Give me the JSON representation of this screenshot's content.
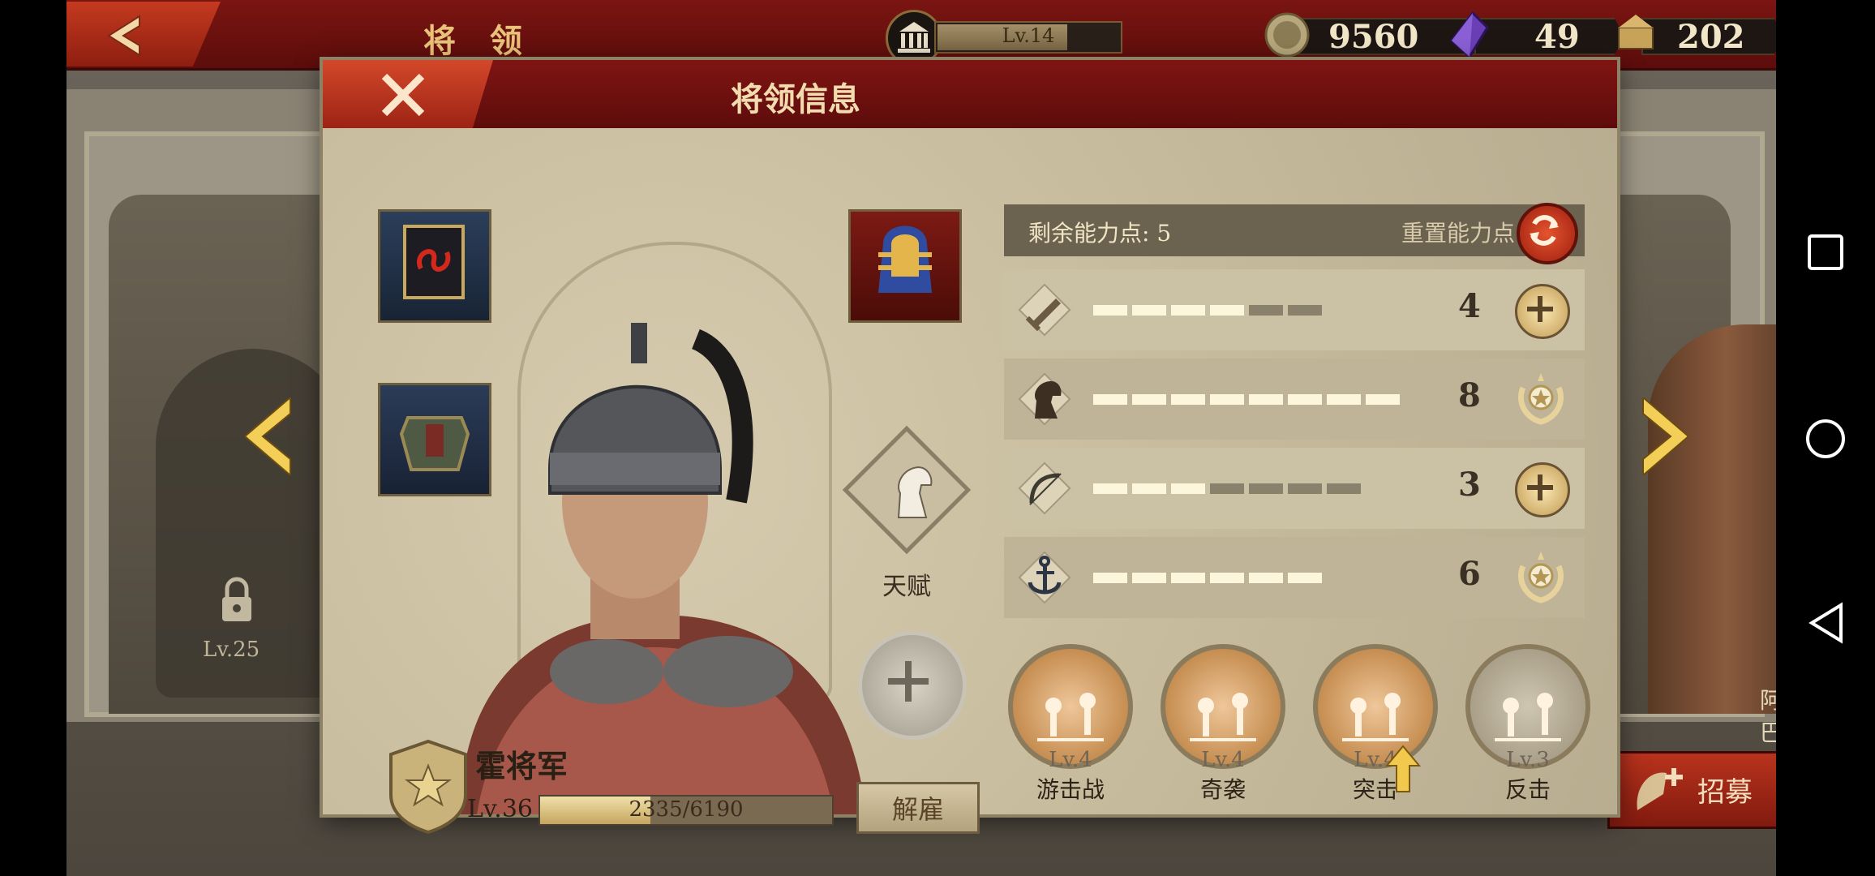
{
  "topbar": {
    "title": "将 领",
    "building_level": "Lv.14",
    "building_progress": 0.7,
    "coins": "9560",
    "gems": "49",
    "laurels": "202"
  },
  "background": {
    "locked_level": "Lv.25",
    "right_name": "阿巴达",
    "recruit_label": "招募"
  },
  "dialog": {
    "title": "将领信息",
    "talent_label": "天赋",
    "general": {
      "name": "霍将军",
      "level": "Lv.36",
      "xp_current": 2335,
      "xp_max": 6190,
      "xp_text": "2335/6190",
      "dismiss_label": "解雇"
    },
    "points": {
      "remaining_label": "剩余能力点: 5",
      "reset_label": "重置能力点"
    },
    "stats": [
      {
        "icon": "sword-icon",
        "value": "4",
        "filled": 4,
        "total": 6,
        "action": "plus"
      },
      {
        "icon": "horse-icon",
        "value": "8",
        "filled": 8,
        "total": 8,
        "action": "max"
      },
      {
        "icon": "bow-icon",
        "value": "3",
        "filled": 3,
        "total": 7,
        "action": "plus"
      },
      {
        "icon": "anchor-icon",
        "value": "6",
        "filled": 6,
        "total": 6,
        "action": "max"
      }
    ],
    "skills": [
      {
        "level": "Lv.4",
        "name": "游击战",
        "active": true
      },
      {
        "level": "Lv.4",
        "name": "奇袭",
        "active": true
      },
      {
        "level": "Lv.4",
        "name": "突击",
        "active": true
      },
      {
        "level": "Lv.3",
        "name": "反击",
        "active": false
      }
    ]
  }
}
